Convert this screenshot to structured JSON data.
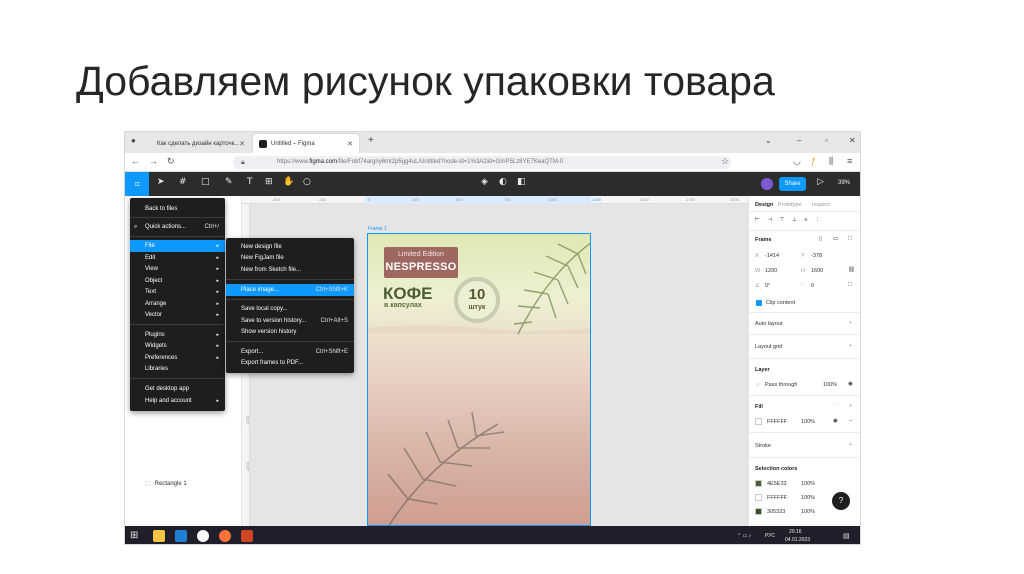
{
  "slide": {
    "title": "Добавляем рисунок упаковки товара"
  },
  "browser": {
    "tabs": [
      {
        "label": "Как сделать дизайн карточк...",
        "active": false
      },
      {
        "label": "Untitled – Figma",
        "active": true
      }
    ],
    "new_tab": "+",
    "url_prefix": "https://www.",
    "url_domain": "figma.com",
    "url_rest": "/file/Fobf74argny6mt2p5gg4uL/Untitled?node-id=1%3A2&t=GmP5Lz8YE7KeaQTM-0"
  },
  "toolbar": {
    "share_label": "Share",
    "zoom": "39%"
  },
  "main_menu": {
    "items": [
      {
        "label": "Back to files",
        "arrow": "",
        "shortcut": ""
      },
      {
        "label": "Quick actions...",
        "arrow": "",
        "shortcut": "Ctrl+/"
      },
      {
        "label": "File",
        "arrow": "▸",
        "shortcut": ""
      },
      {
        "label": "Edit",
        "arrow": "▸",
        "shortcut": ""
      },
      {
        "label": "View",
        "arrow": "▸",
        "shortcut": ""
      },
      {
        "label": "Object",
        "arrow": "▸",
        "shortcut": ""
      },
      {
        "label": "Text",
        "arrow": "▸",
        "shortcut": ""
      },
      {
        "label": "Arrange",
        "arrow": "▸",
        "shortcut": ""
      },
      {
        "label": "Vector",
        "arrow": "▸",
        "shortcut": ""
      },
      {
        "label": "Plugins",
        "arrow": "▸",
        "shortcut": ""
      },
      {
        "label": "Widgets",
        "arrow": "▸",
        "shortcut": ""
      },
      {
        "label": "Preferences",
        "arrow": "▸",
        "shortcut": ""
      },
      {
        "label": "Libraries",
        "arrow": "",
        "shortcut": ""
      },
      {
        "label": "Get desktop app",
        "arrow": "",
        "shortcut": ""
      },
      {
        "label": "Help and account",
        "arrow": "▸",
        "shortcut": ""
      }
    ]
  },
  "file_menu": {
    "items": [
      {
        "label": "New design file",
        "shortcut": ""
      },
      {
        "label": "New FigJam file",
        "shortcut": ""
      },
      {
        "label": "New from Sketch file...",
        "shortcut": ""
      },
      {
        "label": "Place image...",
        "shortcut": "Ctrl+Shift+K"
      },
      {
        "label": "Save local copy...",
        "shortcut": ""
      },
      {
        "label": "Save to version history...",
        "shortcut": "Ctrl+Alt+S"
      },
      {
        "label": "Show version history",
        "shortcut": ""
      },
      {
        "label": "Export...",
        "shortcut": "Ctrl+Shift+E"
      },
      {
        "label": "Export frames to PDF...",
        "shortcut": ""
      }
    ]
  },
  "layers": {
    "rectangle": "Rectangle 1"
  },
  "canvas": {
    "frame_label": "Frame 1",
    "ruler": [
      "-500",
      "-250",
      "0",
      "250",
      "500",
      "750",
      "1000",
      "1250",
      "1500",
      "1750",
      "2000"
    ],
    "ruler_sel": [
      "-1414",
      "1200"
    ],
    "vruler": [
      "1250",
      "1500"
    ]
  },
  "product": {
    "badge_top": "Limited Edition",
    "brand": "NESPRESSO",
    "title": "КОФЕ",
    "subtitle": "в капсулах",
    "count": "10",
    "unit": "штук"
  },
  "right_panel": {
    "tabs": [
      "Design",
      "Prototype",
      "Inspect"
    ],
    "frame_label": "Frame",
    "x_label": "X",
    "x": "-1414",
    "y_label": "Y",
    "y": "-378",
    "w_label": "W",
    "w": "1200",
    "h_label": "H",
    "h": "1600",
    "rot": "0°",
    "radius": "0",
    "clip": "Clip content",
    "auto_layout": "Auto layout",
    "layout_grid": "Layout grid",
    "layer": "Layer",
    "blend": "Pass through",
    "layer_opacity": "100%",
    "fill": "Fill",
    "fill_hex": "FFFFFF",
    "fill_opacity": "100%",
    "stroke": "Stroke",
    "selection_colors": "Selection colors",
    "colors": [
      {
        "hex": "4E5E33",
        "swatch": "#4E5E33",
        "opacity": "100%"
      },
      {
        "hex": "FFFFFF",
        "swatch": "#FFFFFF",
        "opacity": "100%"
      },
      {
        "hex": "305323",
        "swatch": "#305323",
        "opacity": "100%"
      }
    ],
    "help": "?"
  },
  "taskbar": {
    "lang": "РУС",
    "time": "20:16",
    "date": "04.01.2023"
  }
}
